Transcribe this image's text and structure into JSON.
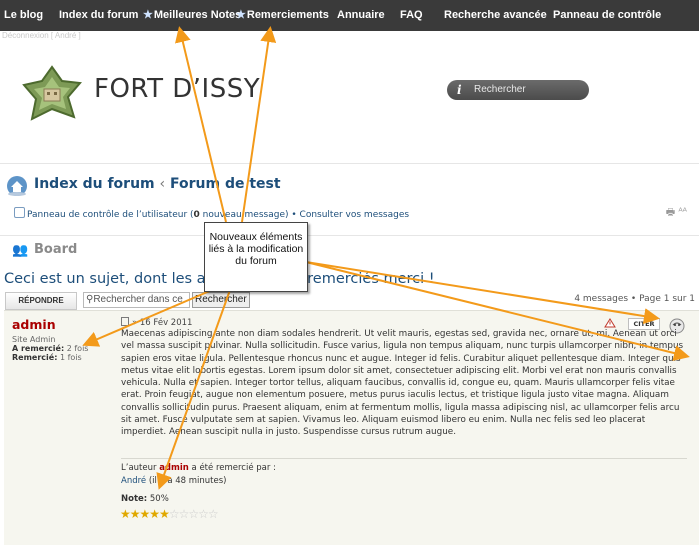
{
  "nav": {
    "items": [
      "Le blog",
      "Index du forum",
      "Meilleures Notes",
      "Remerciements",
      "Annuaire",
      "FAQ",
      "Recherche avancée",
      "Panneau de contrôle"
    ]
  },
  "subnav": {
    "text": "Déconnexion [ André ]"
  },
  "header": {
    "site_title": "FORT D’ISSY",
    "search_placeholder": "Rechercher",
    "search_icon": "info-icon"
  },
  "breadcrumb": {
    "index": "Index du forum",
    "separator": "‹",
    "forum": "Forum de test"
  },
  "ucp": {
    "link": "Panneau de contrôle de l’utilisateur",
    "count_prefix": "(",
    "count": "0",
    "count_suffix": " nouveau message)",
    "bullet": " • ",
    "messages_link": "Consulter vos messages"
  },
  "board": {
    "title": "Board"
  },
  "topic": {
    "title": "Ceci est un sujet, dont les auteurs seront remerciés merci !",
    "reply_label": "RÉPONDRE",
    "search_placeholder": "Rechercher dans ce",
    "search_button": "Rechercher",
    "pagination": "4 messages • Page 1 sur 1"
  },
  "post": {
    "author": "admin",
    "rank": "Site Admin",
    "thanked_label": "A remercié:",
    "thanked_value": "2 fois",
    "received_label": "Remercié:",
    "received_value": "1 fois",
    "date": "» 16 Fév 2011",
    "quote_label": "CITER",
    "body": "Maecenas adipiscing ante non diam sodales hendrerit. Ut velit mauris, egestas sed, gravida nec, ornare ut, mi. Aenean ut orci vel massa suscipit pulvinar. Nulla sollicitudin. Fusce varius, ligula non tempus aliquam, nunc turpis ullamcorper nibh, in tempus sapien eros vitae ligula. Pellentesque rhoncus nunc et augue. Integer id felis. Curabitur aliquet pellentesque diam. Integer quis metus vitae elit lobortis egestas. Lorem ipsum dolor sit amet, consectetuer adipiscing elit. Morbi vel erat non mauris convallis vehicula. Nulla et sapien. Integer tortor tellus, aliquam faucibus, convallis id, congue eu, quam. Mauris ullamcorper felis vitae erat. Proin feugiat, augue non elementum posuere, metus purus iaculis lectus, et tristique ligula justo vitae magna. Aliquam convallis sollicitudin purus. Praesent aliquam, enim at fermentum mollis, ligula massa adipiscing nisl, ac ullamcorper felis arcu sit amet. Fusce vulputate sem at sapien. Vivamus leo. Aliquam euismod libero eu enim. Nulla nec felis sed leo placerat imperdiet. Aenean suscipit nulla in justo. Suspendisse cursus rutrum augue.",
    "thanks_prefix": "L’auteur ",
    "thanks_author": "admin",
    "thanks_suffix": " a été remercié par :",
    "thanked_by_user": "André",
    "thanked_by_time": " (il y a 48 minutes)",
    "rating_label": "Note:",
    "rating_value": "50%",
    "stars_filled": 5,
    "stars_total": 10
  },
  "annotation": {
    "text": "Nouveaux éléments liés à la modification du forum",
    "arrow_color": "#f39a1a"
  }
}
